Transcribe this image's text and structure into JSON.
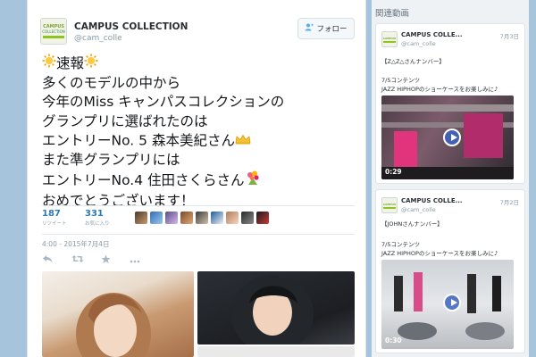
{
  "tweet": {
    "display_name": "CAMPUS COLLECTION",
    "screen_name": "@cam_colle",
    "follow_label": "フォロー",
    "follow_icon": "add-user-icon",
    "avatar_text": "CAMPUS COLLECTION",
    "lines": {
      "l1": "速報",
      "l2": "多くのモデルの中から",
      "l3": "今年のMiss キャンパスコレクションの",
      "l4": "グランプリに選ばれたのは",
      "l5": "エントリーNo. 5 森本美紀さん",
      "l6": "また準グランプリには",
      "l7": "エントリーNo.4 住田さくらさん",
      "l8": "おめでとうございます！"
    },
    "retweets_count": "187",
    "retweets_label": "リツイート",
    "favorites_count": "331",
    "favorites_label": "お気に入り",
    "timestamp": "4:00 - 2015年7月4日",
    "action_icons": [
      "reply-icon",
      "retweet-icon",
      "favorite-icon",
      "more-icon"
    ],
    "accent_color": "#55acee"
  },
  "sidebar": {
    "title": "関連動画",
    "videos": [
      {
        "name": "CAMPUS COLLE...",
        "handle": "@cam_colle",
        "date": "7月3日",
        "text1": "【Z△Z△さんナンバー】",
        "text2": "7/5コンテンツ",
        "text3": "JAZZ HIPHOPのショーケースをお楽しみに♪",
        "duration": "0:29"
      },
      {
        "name": "CAMPUS COLLE...",
        "handle": "@cam_colle",
        "date": "7月2日",
        "text1": "【JOHNさんナンバー】",
        "text2": "7/5コンテンツ",
        "text3": "JAZZ HIPHOPのショーケースをお楽しみに♪",
        "duration": "0:30"
      }
    ]
  }
}
